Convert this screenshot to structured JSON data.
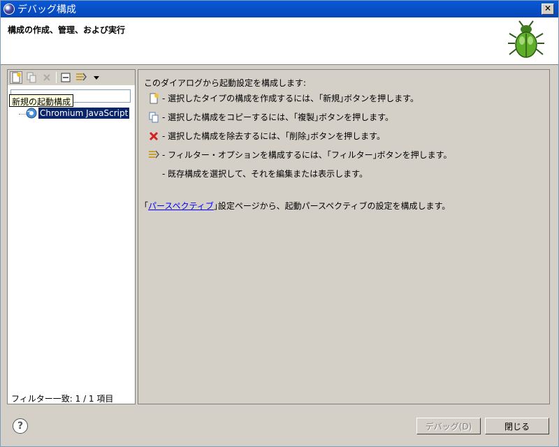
{
  "window": {
    "title": "デバッグ構成",
    "close_glyph": "✕"
  },
  "header": {
    "title": "構成の作成、管理、および実行"
  },
  "left": {
    "filter_placeholder": "",
    "tooltip": "新規の起動構成",
    "tree": [
      {
        "label": "Chromium JavaScript",
        "selected": true
      }
    ],
    "match_status": "フィルター一致: 1 / 1 項目"
  },
  "right": {
    "intro": "このダイアログから起動設定を構成します:",
    "items": [
      {
        "icon": "new-config-icon",
        "text": "- 選択したタイプの構成を作成するには、｢新規｣ボタンを押します。"
      },
      {
        "icon": "duplicate-icon",
        "text": "- 選択した構成をコピーするには、｢複製｣ボタンを押します。"
      },
      {
        "icon": "delete-icon",
        "text": "- 選択した構成を除去するには、｢削除｣ボタンを押します。"
      },
      {
        "icon": "filter-icon",
        "text": "- フィルター・オプションを構成するには、｢フィルター｣ボタンを押します。"
      },
      {
        "icon": "",
        "text": "- 既存構成を選択して、それを編集または表示します。"
      }
    ],
    "persp_prefix": "｢",
    "persp_link": "パースペクティブ",
    "persp_suffix": "｣設定ページから、起動パースペクティブの設定を構成します。"
  },
  "footer": {
    "help": "?",
    "debug": "デバッグ(D)",
    "close": "閉じる"
  },
  "colors": {
    "selection": "#0a246a",
    "link": "#0000ff",
    "titlebar": "#0a58d6"
  }
}
